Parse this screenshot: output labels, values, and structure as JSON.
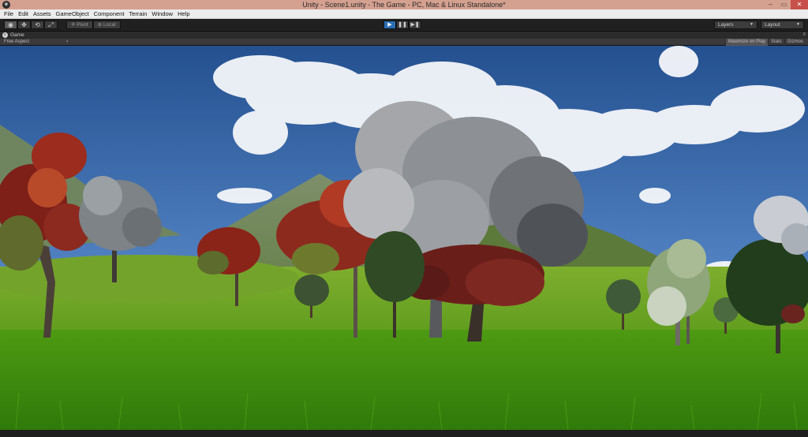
{
  "window": {
    "title": "Unity - Scene1.unity - The Game - PC, Mac & Linux Standalone*",
    "app_icon": "unity-icon",
    "controls": {
      "minimize": "–",
      "maximize": "▭",
      "close": "✕"
    }
  },
  "menu": {
    "items": [
      {
        "label": "File"
      },
      {
        "label": "Edit"
      },
      {
        "label": "Assets"
      },
      {
        "label": "GameObject"
      },
      {
        "label": "Component"
      },
      {
        "label": "Terrain"
      },
      {
        "label": "Window"
      },
      {
        "label": "Help"
      }
    ]
  },
  "toolbar": {
    "tools": [
      {
        "icon": "hand-eye-icon",
        "glyph": "◉",
        "active": true
      },
      {
        "icon": "move-icon",
        "glyph": "✥",
        "active": false
      },
      {
        "icon": "rotate-icon",
        "glyph": "⟲",
        "active": false
      },
      {
        "icon": "scale-icon",
        "glyph": "⤢",
        "active": false
      }
    ],
    "pivot_label": "Pivot",
    "local_label": "Local",
    "play": {
      "glyph": "▶",
      "active": true
    },
    "pause": {
      "glyph": "❚❚",
      "active": false
    },
    "step": {
      "glyph": "▶❚",
      "active": false
    },
    "layers_label": "Layers",
    "layout_label": "Layout"
  },
  "game_panel": {
    "tab_label": "Game",
    "tab_icon": "game-icon",
    "aspect_label": "Free Aspect",
    "maximize_label": "Maximize on Play",
    "stats_label": "Stats",
    "gizmos_label": "Gizmos"
  },
  "colors": {
    "sky_top": "#2d5a9e",
    "sky_bottom": "#8cb0d8",
    "grass": "#3f8c12",
    "play_active": "#2b6fb5",
    "titlebar": "#d4a090"
  }
}
